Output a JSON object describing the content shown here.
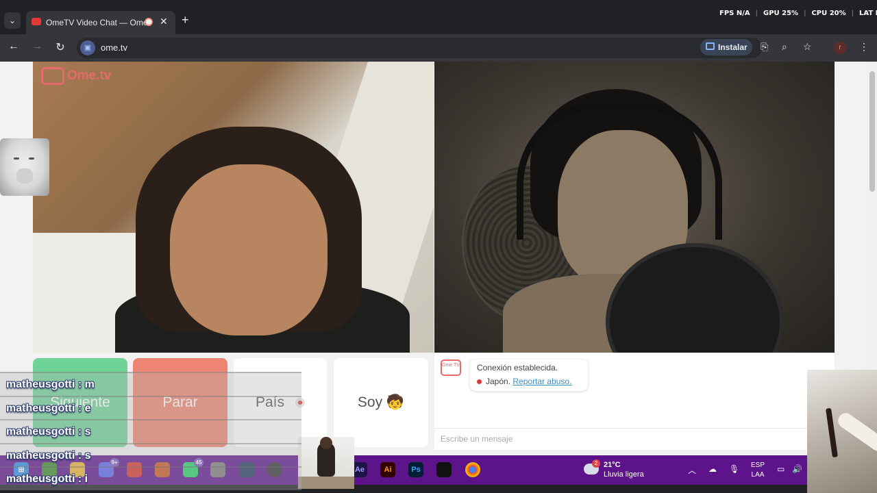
{
  "browser": {
    "tab_title": "OmeTV Video Chat — Ome",
    "url": "ome.tv",
    "install_label": "Instalar",
    "profile_initial": "r"
  },
  "stats": {
    "fps": "FPS N/A",
    "gpu": "GPU 25%",
    "cpu": "CPU 20%",
    "lat": "LAT N/A"
  },
  "page": {
    "logo_text": "Ome.tv",
    "buttons": {
      "next": "Siguiente",
      "stop": "Parar",
      "country": "País",
      "soy": "Soy 🧒"
    },
    "chat": {
      "logo": "Ome TV",
      "status": "Conexión establecida.",
      "country": "Japón.",
      "report_link": "Reportar abuso.",
      "input_placeholder": "Escribe un mensaje"
    }
  },
  "overlay_chat": [
    {
      "text": "matheusgotti : m"
    },
    {
      "text": "matheusgotti : e"
    },
    {
      "text": "matheusgotti : s"
    },
    {
      "text": "matheusgotti : s"
    },
    {
      "text": "matheusgotti : i"
    }
  ],
  "taskbar": {
    "badges": {
      "discord": "9+",
      "whatsapp": "45"
    },
    "apps": {
      "ae": "Ae",
      "ai": "Ai",
      "ps": "Ps"
    },
    "weather_badge": "2",
    "temp": "21°C",
    "weather_desc": "Lluvia ligera",
    "lang_line1": "ESP",
    "lang_line2": "LAA"
  }
}
